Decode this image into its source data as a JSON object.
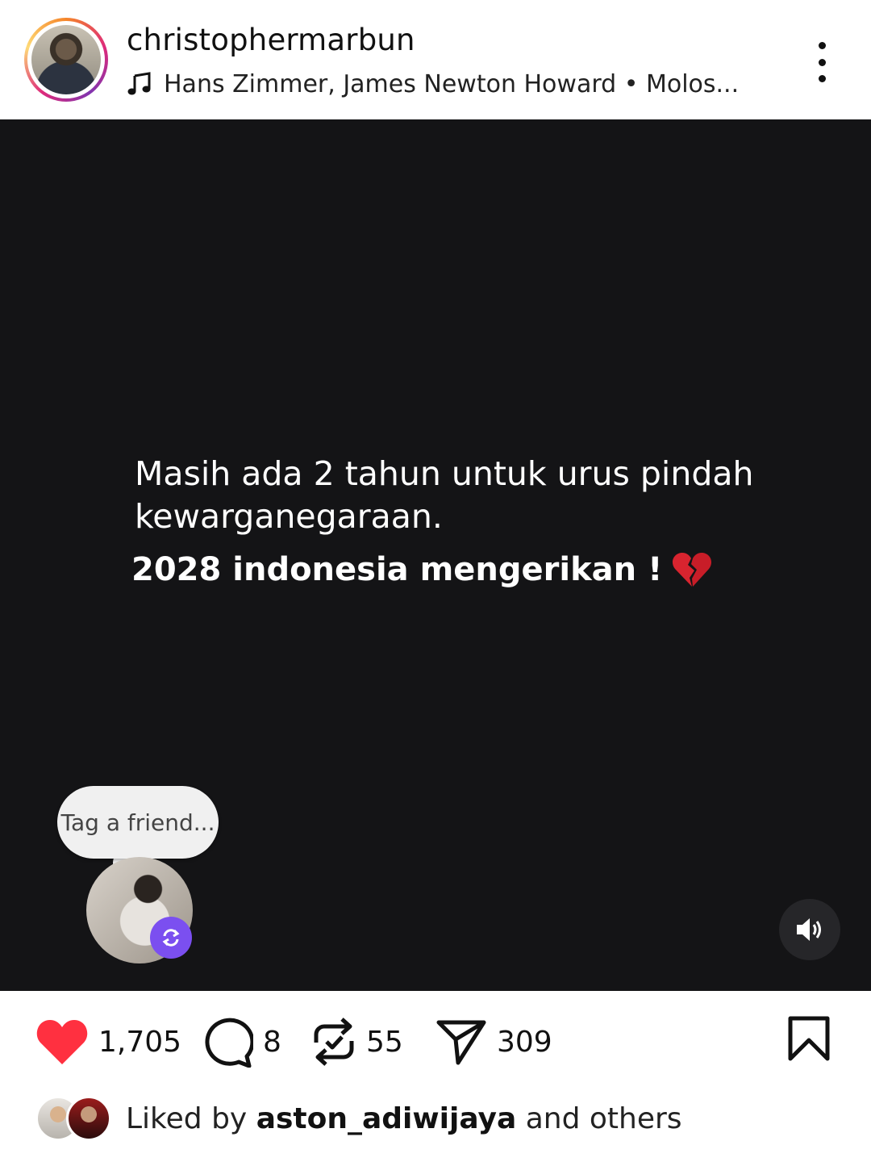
{
  "post": {
    "username": "christophermarbun",
    "music": "Hans Zimmer, James Newton Howard • Molos..."
  },
  "media": {
    "text_line1": "Masih ada 2 tahun untuk urus pindah kewarganegaraan.",
    "text_line2": "2028 indonesia mengerikan !",
    "text_emoji": "broken-heart-icon",
    "tag_prompt": "Tag a friend..."
  },
  "actions": {
    "likes": "1,705",
    "comments": "8",
    "reposts": "55",
    "shares": "309"
  },
  "liked_by": {
    "prefix": "Liked by",
    "user": "aston_adiwijaya",
    "suffix": "and others"
  },
  "colors": {
    "like": "#ff3040",
    "media_bg": "#141416",
    "badge": "#7b4ff0"
  }
}
